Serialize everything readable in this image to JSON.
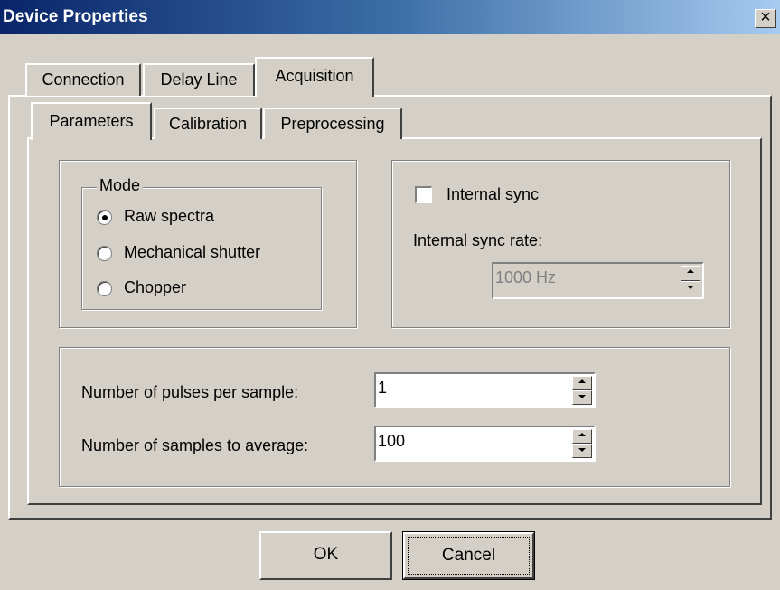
{
  "window": {
    "title": "Device Properties",
    "close_glyph": "×"
  },
  "outer_tabs": [
    {
      "label": "Connection"
    },
    {
      "label": "Delay Line"
    },
    {
      "label": "Acquisition"
    }
  ],
  "inner_tabs": [
    {
      "label": "Parameters"
    },
    {
      "label": "Calibration"
    },
    {
      "label": "Preprocessing"
    }
  ],
  "mode": {
    "legend": "Mode",
    "options": [
      {
        "label": "Raw spectra",
        "selected": true
      },
      {
        "label": "Mechanical shutter",
        "selected": false
      },
      {
        "label": "Chopper",
        "selected": false
      }
    ]
  },
  "sync": {
    "internal_sync_label": "Internal sync",
    "internal_sync_checked": false,
    "rate_label": "Internal sync rate:",
    "rate_value": "1000 Hz"
  },
  "acquisition": {
    "pulses_label": "Number of pulses per sample:",
    "pulses_value": "1",
    "samples_label": "Number of samples to average:",
    "samples_value": "100"
  },
  "buttons": {
    "ok": "OK",
    "cancel": "Cancel"
  },
  "icons": {
    "close": "close-icon",
    "spin_up": "spin-up-icon",
    "spin_down": "spin-down-icon"
  }
}
